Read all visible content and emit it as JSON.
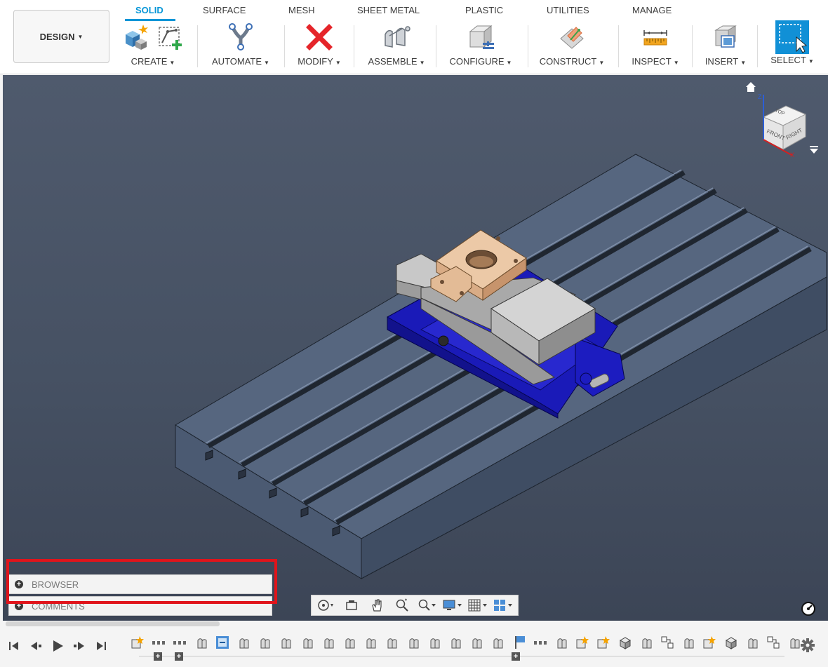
{
  "workspace": {
    "label": "DESIGN"
  },
  "tabs": [
    {
      "label": "SOLID",
      "active": true
    },
    {
      "label": "SURFACE",
      "active": false
    },
    {
      "label": "MESH",
      "active": false
    },
    {
      "label": "SHEET METAL",
      "active": false
    },
    {
      "label": "PLASTIC",
      "active": false
    },
    {
      "label": "UTILITIES",
      "active": false
    },
    {
      "label": "MANAGE",
      "active": false
    }
  ],
  "groups": [
    {
      "label": "CREATE",
      "icons": [
        "new-component-icon",
        "create-sketch-icon"
      ]
    },
    {
      "label": "AUTOMATE",
      "icons": [
        "automate-icon"
      ]
    },
    {
      "label": "MODIFY",
      "icons": [
        "modify-icon"
      ]
    },
    {
      "label": "ASSEMBLE",
      "icons": [
        "assemble-joint-icon"
      ]
    },
    {
      "label": "CONFIGURE",
      "icons": [
        "configure-icon"
      ]
    },
    {
      "label": "CONSTRUCT",
      "icons": [
        "construct-plane-icon"
      ]
    },
    {
      "label": "INSPECT",
      "icons": [
        "measure-icon"
      ]
    },
    {
      "label": "INSERT",
      "icons": [
        "insert-image-icon"
      ]
    },
    {
      "label": "SELECT",
      "icons": [
        "select-icon"
      ]
    }
  ],
  "viewcube": {
    "top": "TOP",
    "front": "FRONT",
    "right": "RIGHT",
    "axis_x": "X",
    "axis_z": "Z"
  },
  "panel": {
    "browser_label": "BROWSER",
    "comments_label": "COMMENTS"
  },
  "colors": {
    "accent": "#0696d7",
    "highlight": "#e0141b",
    "vise_body": "#1a1ab8",
    "workpiece": "#e7c3a4",
    "table": "#52627d"
  },
  "navbar": {
    "icons": [
      "orbit-icon",
      "look-at-icon",
      "pan-icon",
      "zoom-icon",
      "fit-icon",
      "display-settings-icon",
      "grid-icon",
      "viewports-icon"
    ]
  },
  "timeline": {
    "controls": [
      "skip-to-start-icon",
      "step-back-icon",
      "play-icon",
      "step-forward-icon",
      "skip-to-end-icon"
    ],
    "features": [
      "component-icon",
      "group-icon",
      "group-icon",
      "joint-icon",
      "rigid-group-icon",
      "joint-icon",
      "joint-icon",
      "joint-icon",
      "joint-icon",
      "joint-icon",
      "joint-icon",
      "joint-icon",
      "joint-icon",
      "joint-icon",
      "joint-icon",
      "joint-icon",
      "joint-icon",
      "joint-icon",
      "flag-icon",
      "group-icon",
      "joint-icon",
      "component-icon",
      "component-icon",
      "body-icon",
      "joint-icon",
      "pattern-icon",
      "joint-icon",
      "component-icon",
      "body-icon",
      "joint-icon",
      "pattern-icon",
      "joint-icon"
    ]
  }
}
